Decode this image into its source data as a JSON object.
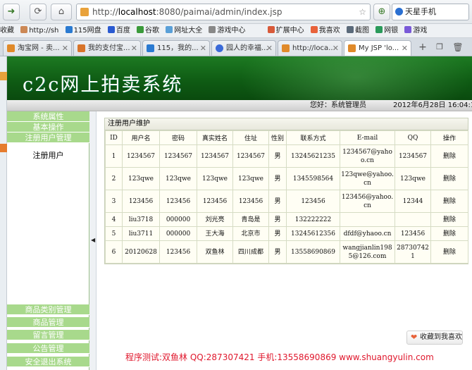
{
  "browser": {
    "url_prefix": "http://",
    "url_host": "localhost",
    "url_rest": ":8080/paimai/admin/index.jsp",
    "search_text": "天星手机",
    "bookmarks": [
      "收藏",
      "http://sh",
      "115网盘",
      "百度",
      "谷歌",
      "网址大全",
      "游戏中心",
      "扩展中心",
      "我喜欢",
      "截图",
      "网银",
      "游戏"
    ],
    "tabs": [
      "淘宝网 - 卖...",
      "我的支付宝...",
      "115，我的...",
      "园人的幸福...",
      "http://loca...",
      "My JSP 'lo..."
    ]
  },
  "banner": {
    "title": "c2c网上拍卖系统"
  },
  "infobar": {
    "greeting": "您好：系统管理员",
    "date": "2012年6月28日  16:04:10"
  },
  "menu": {
    "top_items": [
      "系统属性",
      "基本操作",
      "注册用户管理"
    ],
    "sub_item": "注册用户",
    "bottom_items": [
      "商品类别管理",
      "商品管理",
      "留言管理",
      "公告管理",
      "安全退出系统"
    ]
  },
  "panel": {
    "title": "注册用户维护",
    "columns": [
      "ID",
      "用户名",
      "密码",
      "真实姓名",
      "住址",
      "性别",
      "联系方式",
      "E-mail",
      "QQ",
      "操作"
    ],
    "rows": [
      [
        "1",
        "1234567",
        "1234567",
        "1234567",
        "1234567",
        "男",
        "13245621235",
        "1234567@yahoo.cn",
        "1234567",
        "删除"
      ],
      [
        "2",
        "123qwe",
        "123qwe",
        "123qwe",
        "123qwe",
        "男",
        "1345598564",
        "123qwe@yahoo.cn",
        "123qwe",
        "删除"
      ],
      [
        "3",
        "123456",
        "123456",
        "123456",
        "123456",
        "男",
        "123456",
        "123456@yahoo.cn",
        "12344",
        "删除"
      ],
      [
        "4",
        "liu3718",
        "000000",
        "刘光亮",
        "青岛是",
        "男",
        "132222222",
        "",
        "",
        "删除"
      ],
      [
        "5",
        "liu3711",
        "000000",
        "王大海",
        "北京市",
        "男",
        "13245612356",
        "dfdf@yhaoo.cn",
        "123456",
        "删除"
      ],
      [
        "6",
        "20120628",
        "123456",
        "双鱼林",
        "四川成都",
        "男",
        "13558690869",
        "wangjianlin1985@126.com",
        "287307421",
        "删除"
      ]
    ]
  },
  "fav_button": "收藏到我喜欢",
  "footer": "程序测试:双鱼林 QQ:287307421 手机:13558690869 www.shuangyulin.com"
}
